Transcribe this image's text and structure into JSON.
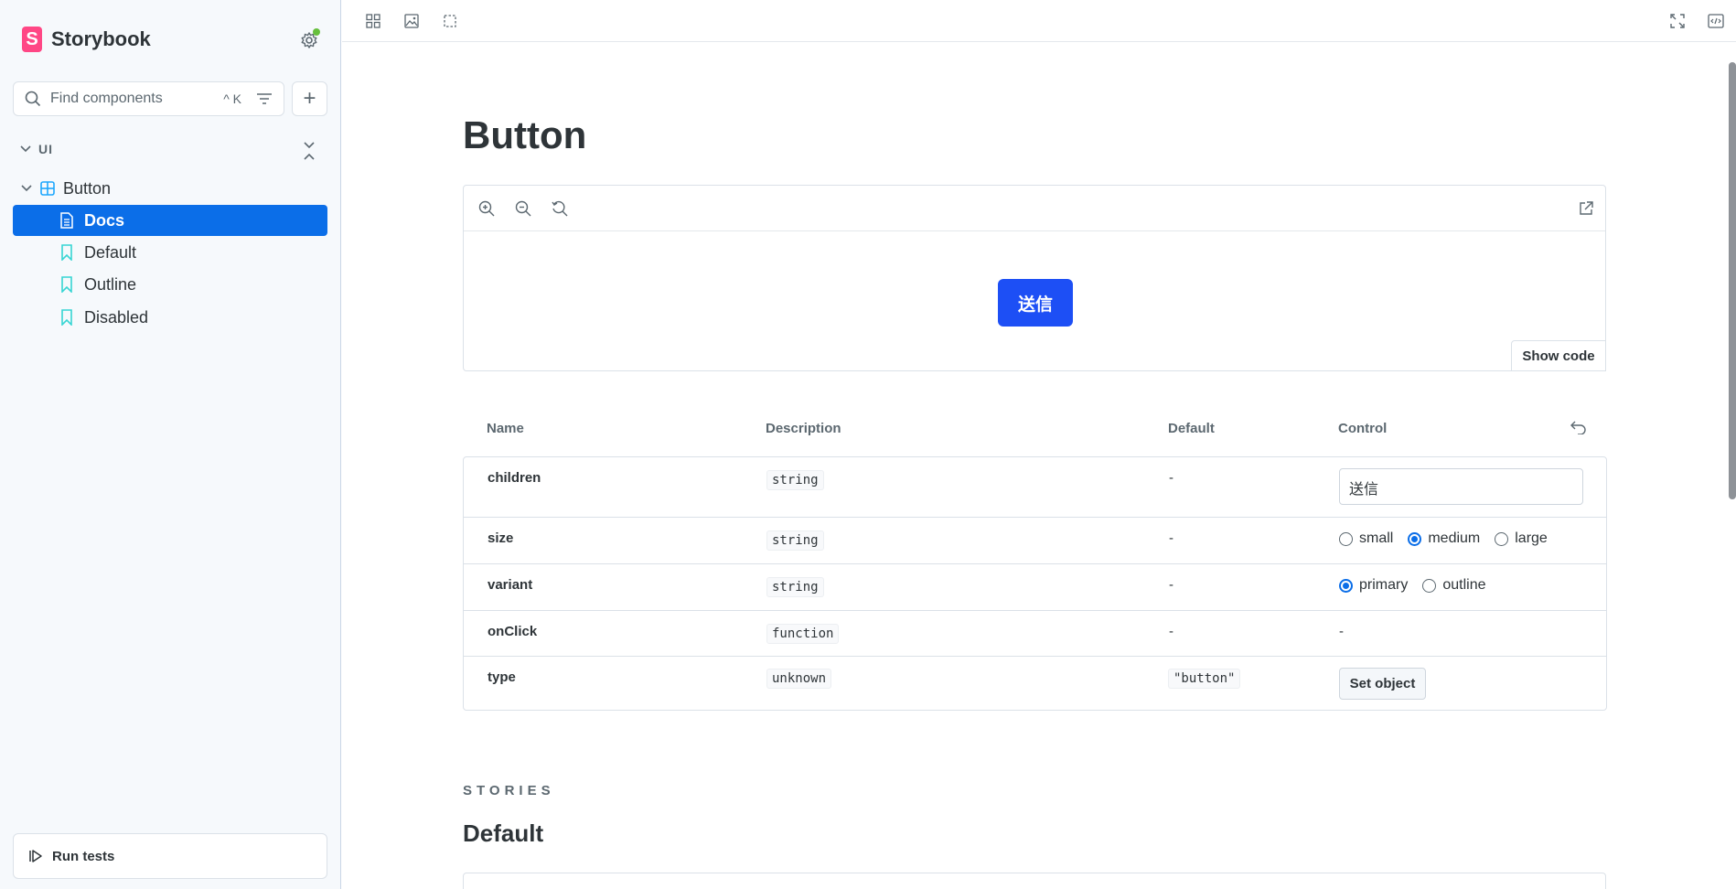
{
  "sidebar": {
    "brand": "Storybook",
    "search": {
      "placeholder": "Find components",
      "shortcut": "^ K"
    },
    "group": "UI",
    "tree": [
      {
        "label": "Button",
        "icon": "component-icon"
      },
      {
        "label": "Docs",
        "icon": "document-icon",
        "active": true
      },
      {
        "label": "Default",
        "icon": "bookmark-icon"
      },
      {
        "label": "Outline",
        "icon": "bookmark-icon"
      },
      {
        "label": "Disabled",
        "icon": "bookmark-icon"
      }
    ],
    "run_tests": "Run tests"
  },
  "docs": {
    "title": "Button",
    "preview": {
      "button_label": "送信",
      "show_code": "Show code"
    },
    "argtable": {
      "headers": {
        "name": "Name",
        "description": "Description",
        "default": "Default",
        "control": "Control"
      },
      "rows": [
        {
          "name": "children",
          "type": "string",
          "default": "-",
          "control_value": "送信"
        },
        {
          "name": "size",
          "type": "string",
          "default": "-",
          "options": [
            "small",
            "medium",
            "large"
          ],
          "selected": "medium"
        },
        {
          "name": "variant",
          "type": "string",
          "default": "-",
          "options": [
            "primary",
            "outline"
          ],
          "selected": "primary"
        },
        {
          "name": "onClick",
          "type": "function",
          "default": "-",
          "control_value": "-"
        },
        {
          "name": "type",
          "type": "unknown",
          "default": "\"button\"",
          "control_button": "Set object"
        }
      ]
    },
    "stories_label": "STORIES",
    "story_title": "Default"
  },
  "colors": {
    "accent": "#0b6ee8",
    "demo_button": "#1d4ff5",
    "brand": "#ff4785",
    "status_dot": "#66bf3c"
  }
}
